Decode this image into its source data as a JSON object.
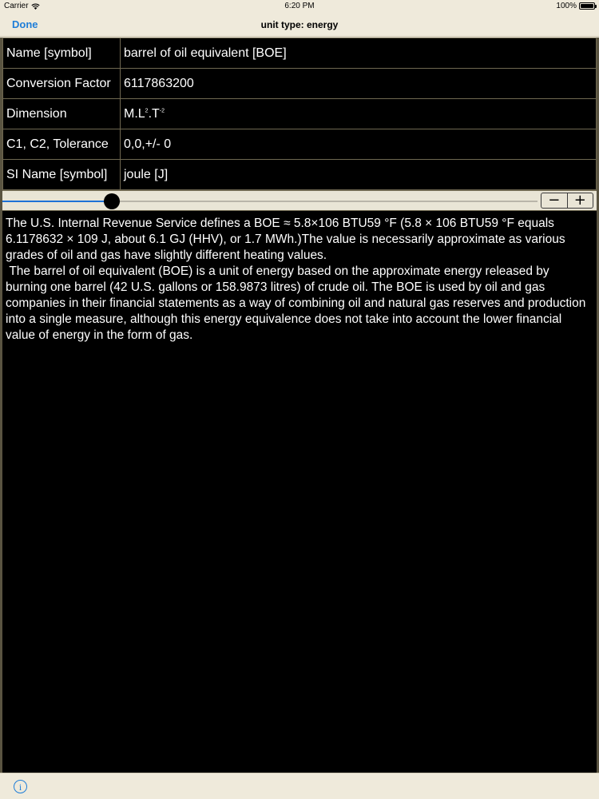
{
  "status_bar": {
    "carrier": "Carrier",
    "wifi_icon": "wifi-icon",
    "time": "6:20 PM",
    "battery_percent": "100%",
    "battery_level": 1.0
  },
  "nav": {
    "done_label": "Done",
    "title": "unit type: energy"
  },
  "table": {
    "rows": [
      {
        "label": "Name [symbol]",
        "value": "barrel of oil equivalent [BOE]"
      },
      {
        "label": "Conversion Factor",
        "value": "6117863200"
      },
      {
        "label": "Dimension",
        "value_base": "M.L",
        "value_exp1": "2",
        "value_mid": ".T",
        "value_exp2": "-2"
      },
      {
        "label": "C1, C2, Tolerance",
        "value": "0,0,+/- 0"
      },
      {
        "label": "SI Name [symbol]",
        "value": "joule [J]"
      }
    ]
  },
  "slider": {
    "level": 0.205,
    "accent_color": "#1e72d6"
  },
  "stepper": {
    "minus_label": "−",
    "plus_label": "+"
  },
  "description": {
    "paragraph1": "The U.S. Internal Revenue Service defines a BOE ≈ 5.8×106 BTU59 °F (5.8 × 106 BTU59 °F equals 6.1178632 × 109 J, about 6.1 GJ (HHV), or 1.7 MWh.)The value is necessarily approximate as various grades of oil and gas have slightly different heating values.",
    "paragraph2": " The barrel of oil equivalent (BOE) is a unit of energy based on the approximate energy released by burning one barrel (42 U.S. gallons or 158.9873 litres) of crude oil. The BOE is used by oil and gas companies in their financial statements as a way of combining oil and natural gas reserves and production into a single measure, although this energy equivalence does not take into account the lower financial value of energy in the form of gas."
  },
  "bottom_bar": {
    "info_label": "i",
    "info_icon": "info-icon"
  }
}
